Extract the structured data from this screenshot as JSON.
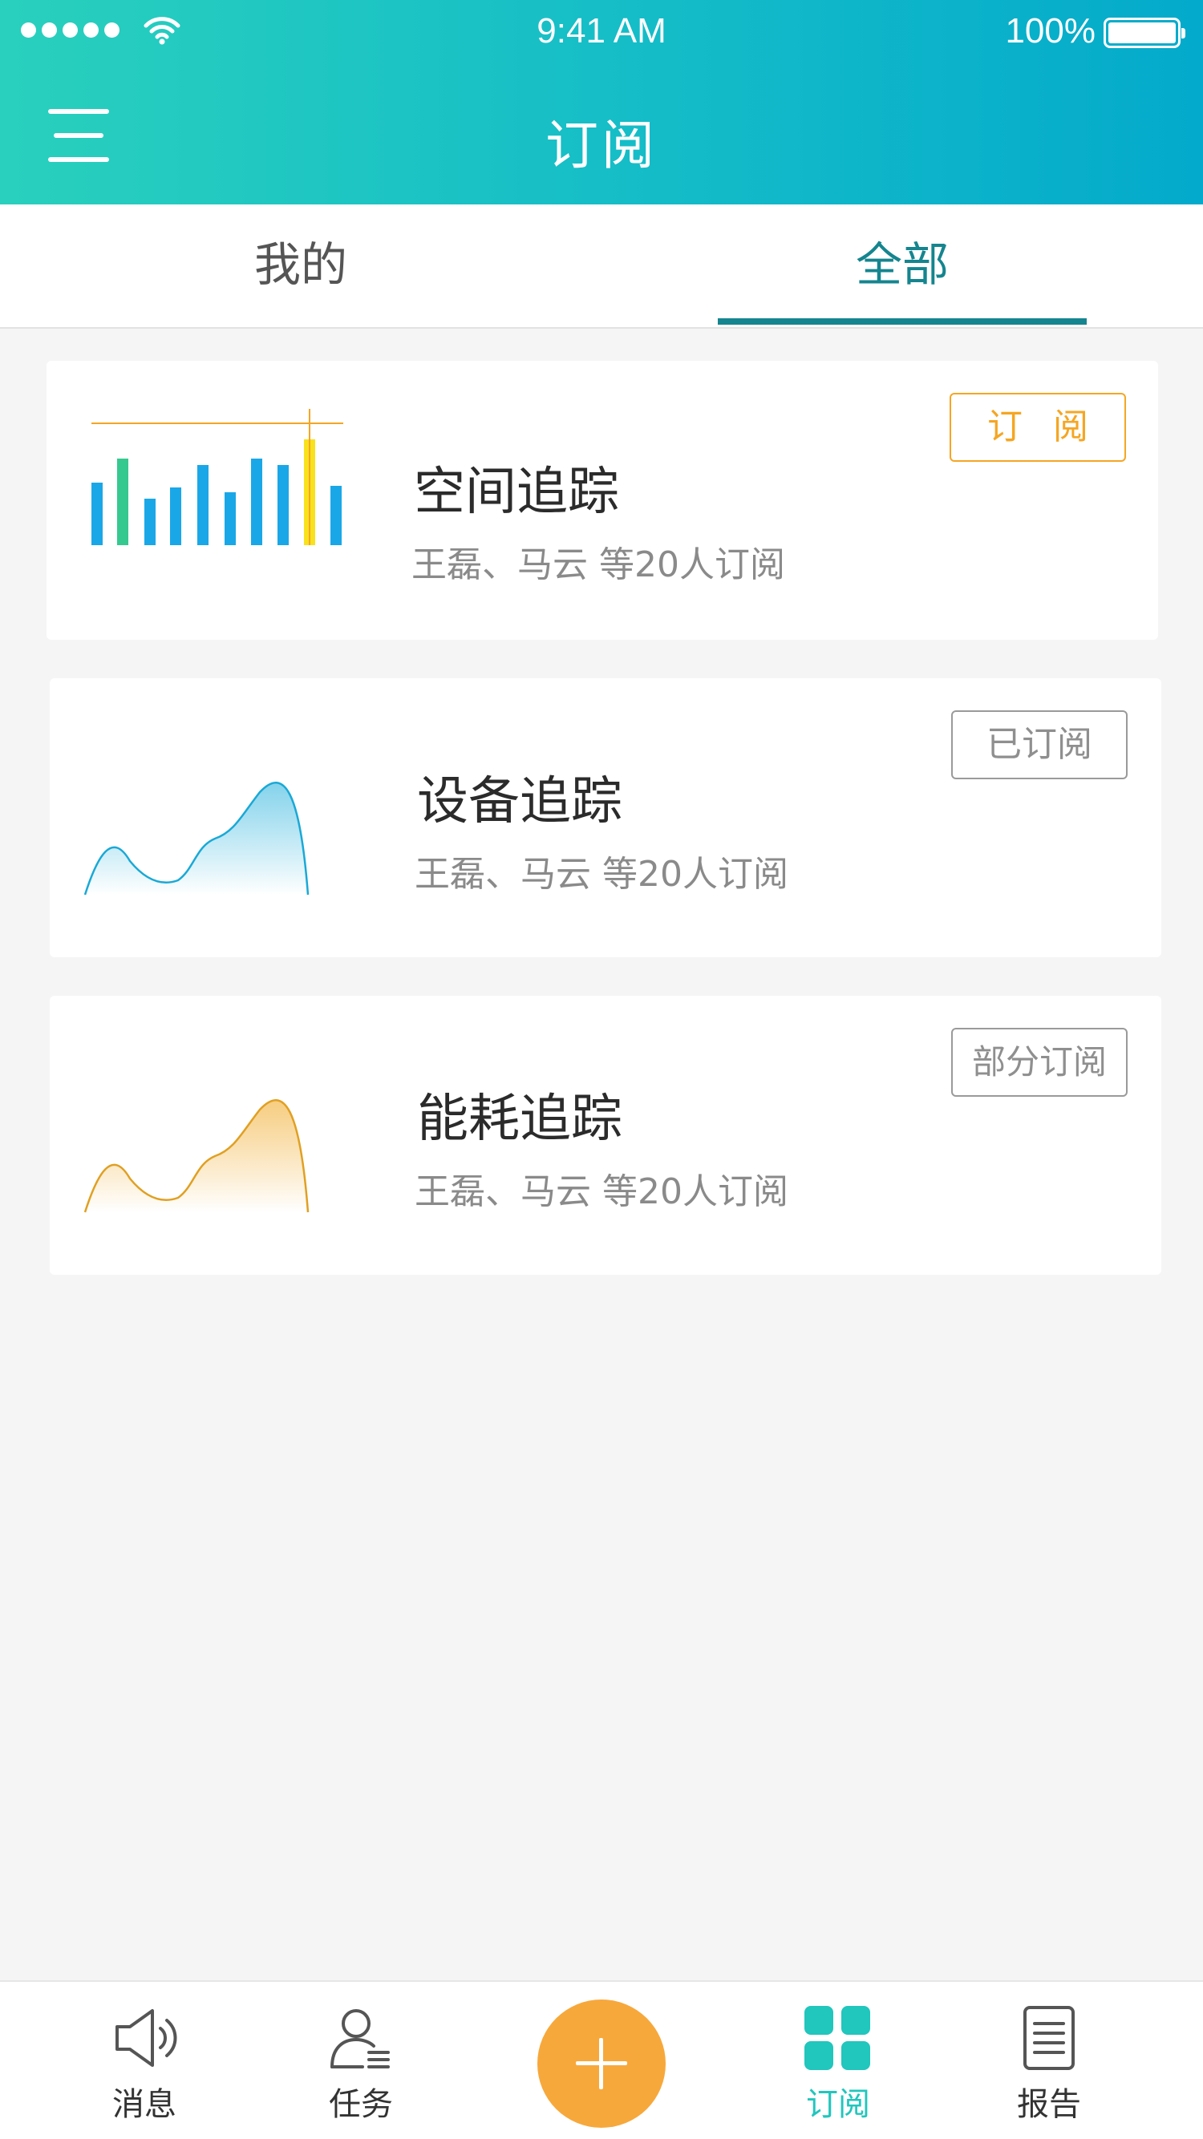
{
  "status_bar": {
    "time": "9:41 AM",
    "battery": "100%"
  },
  "header": {
    "title": "订阅"
  },
  "tabs": [
    {
      "label": "我的"
    },
    {
      "label": "全部",
      "active": true
    }
  ],
  "cards": [
    {
      "title": "空间追踪",
      "subtitle": "王磊、马云 等20人订阅",
      "button": "订 阅",
      "chart": "bar"
    },
    {
      "title": "设备追踪",
      "subtitle": "王磊、马云 等20人订阅",
      "button": "已订阅",
      "chart": "area-blue"
    },
    {
      "title": "能耗追踪",
      "subtitle": "王磊、马云 等20人订阅",
      "button": "部分订阅",
      "chart": "area-orange"
    }
  ],
  "bottom_nav": [
    {
      "label": "消息",
      "icon": "speaker-icon"
    },
    {
      "label": "任务",
      "icon": "user-task-icon"
    },
    {
      "label": "",
      "icon": "plus-icon"
    },
    {
      "label": "订阅",
      "icon": "grid-icon",
      "active": true
    },
    {
      "label": "报告",
      "icon": "document-icon"
    }
  ],
  "colors": {
    "header_start": "#29d0bd",
    "header_end": "#04aacb",
    "active_tab": "#15858f",
    "subscribe_orange": "#f5a623",
    "fab": "#f7a83b",
    "nav_active": "#21c6bd"
  }
}
